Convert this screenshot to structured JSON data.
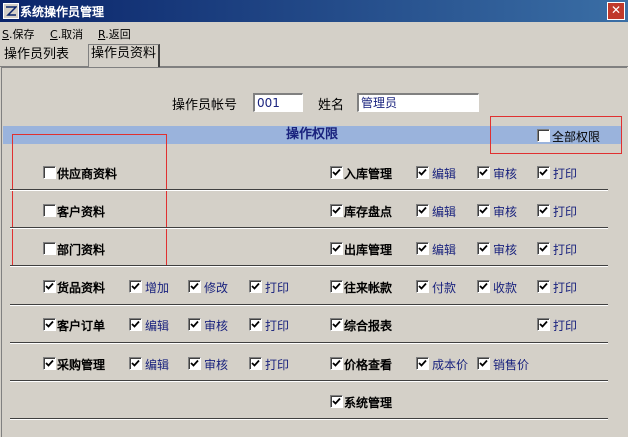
{
  "window": {
    "title": "系统操作员管理",
    "close_glyph": "✕"
  },
  "toolbar": [
    {
      "key": "S",
      "rest": ".保存"
    },
    {
      "key": "C",
      "rest": ".取消"
    },
    {
      "key": "R",
      "rest": ".返回"
    }
  ],
  "tabs": [
    {
      "label": "操作员列表",
      "active": false
    },
    {
      "label": "操作员资料",
      "active": true
    }
  ],
  "form": {
    "account_label": "操作员帐号",
    "account_value": "001",
    "name_label": "姓名",
    "name_value": "管理员"
  },
  "permissions": {
    "title": "操作权限",
    "all_label": "全部权限",
    "all_checked": false,
    "rows": [
      {
        "left": {
          "label": "供应商资料",
          "checked": false,
          "subs": []
        },
        "right": {
          "label": "入库管理",
          "checked": true,
          "subs": [
            {
              "label": "编辑",
              "checked": true
            },
            {
              "label": "审核",
              "checked": true
            },
            {
              "label": "打印",
              "checked": true
            }
          ]
        }
      },
      {
        "left": {
          "label": "客户资料",
          "checked": false,
          "subs": []
        },
        "right": {
          "label": "库存盘点",
          "checked": true,
          "subs": [
            {
              "label": "编辑",
              "checked": true
            },
            {
              "label": "审核",
              "checked": true
            },
            {
              "label": "打印",
              "checked": true
            }
          ]
        }
      },
      {
        "left": {
          "label": "部门资料",
          "checked": false,
          "subs": []
        },
        "right": {
          "label": "出库管理",
          "checked": true,
          "subs": [
            {
              "label": "编辑",
              "checked": true
            },
            {
              "label": "审核",
              "checked": true
            },
            {
              "label": "打印",
              "checked": true
            }
          ]
        }
      },
      {
        "left": {
          "label": "货品资料",
          "checked": true,
          "subs": [
            {
              "label": "增加",
              "checked": true
            },
            {
              "label": "修改",
              "checked": true
            },
            {
              "label": "打印",
              "checked": true
            }
          ]
        },
        "right": {
          "label": "往来帐款",
          "checked": true,
          "subs": [
            {
              "label": "付款",
              "checked": true
            },
            {
              "label": "收款",
              "checked": true
            },
            {
              "label": "打印",
              "checked": true
            }
          ]
        }
      },
      {
        "left": {
          "label": "客户订单",
          "checked": true,
          "subs": [
            {
              "label": "编辑",
              "checked": true
            },
            {
              "label": "审核",
              "checked": true
            },
            {
              "label": "打印",
              "checked": true
            }
          ]
        },
        "right": {
          "label": "综合报表",
          "checked": true,
          "subs": [
            null,
            null,
            {
              "label": "打印",
              "checked": true
            }
          ]
        }
      },
      {
        "left": {
          "label": "采购管理",
          "checked": true,
          "subs": [
            {
              "label": "编辑",
              "checked": true
            },
            {
              "label": "审核",
              "checked": true
            },
            {
              "label": "打印",
              "checked": true
            }
          ]
        },
        "right": {
          "label": "价格查看",
          "checked": true,
          "subs": [
            {
              "label": "成本价",
              "checked": true
            },
            {
              "label": "销售价",
              "checked": true
            }
          ]
        }
      },
      {
        "left": null,
        "right": {
          "label": "系统管理",
          "checked": true,
          "subs": []
        }
      }
    ]
  }
}
